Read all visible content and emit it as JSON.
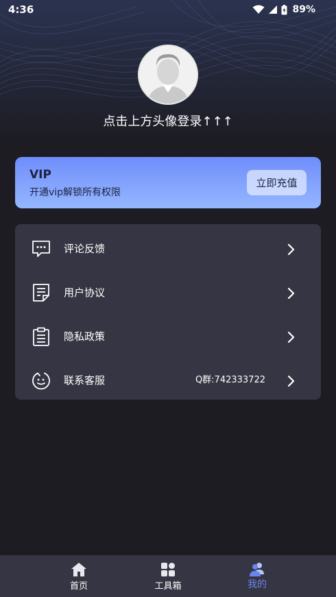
{
  "status_bar": {
    "time": "4:36",
    "battery": "89%",
    "icons": [
      "wifi-icon",
      "signal-icon",
      "battery-icon"
    ]
  },
  "profile": {
    "login_hint": "点击上方头像登录↑↑↑"
  },
  "vip": {
    "title": "VIP",
    "subtitle": "开通vip解锁所有权限",
    "button_label": "立即充值",
    "colors": {
      "gradient_start": "#6f8dfb",
      "gradient_end": "#95b7ff"
    }
  },
  "menu": {
    "items": [
      {
        "label": "评论反馈",
        "icon": "comment-icon",
        "extra": ""
      },
      {
        "label": "用户协议",
        "icon": "document-icon",
        "extra": ""
      },
      {
        "label": "隐私政策",
        "icon": "clipboard-icon",
        "extra": ""
      },
      {
        "label": "联系客服",
        "icon": "customer-service-icon",
        "extra": "Q群:742333722"
      }
    ]
  },
  "bottom_nav": {
    "items": [
      {
        "label": "首页",
        "icon": "home-icon",
        "active": false
      },
      {
        "label": "工具箱",
        "icon": "toolbox-icon",
        "active": false
      },
      {
        "label": "我的",
        "icon": "user-group-icon",
        "active": true
      }
    ]
  },
  "colors": {
    "background": "#1c1c22",
    "card": "#363543",
    "accent": "#6a84f0"
  }
}
